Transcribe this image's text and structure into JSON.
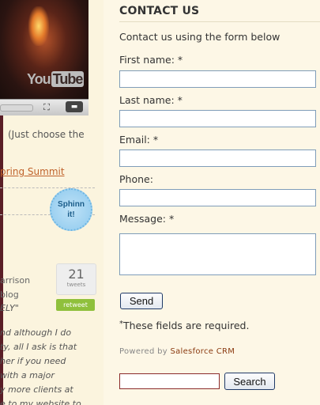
{
  "left_column": {
    "video": {
      "logo_text": "You",
      "logo_tube": "Tube"
    },
    "choose_text": "(Just choose the",
    "spring_link": "pring Summit",
    "sphinn": {
      "line1": "Sphinn",
      "line2": "it!"
    },
    "tweets": {
      "count": "21",
      "label": "tweets",
      "retweet": "retweet"
    },
    "harrison_lines": [
      "arrison",
      "blog",
      "ELY\""
    ],
    "italic_lines": [
      "nd although I do",
      "ty, all I ask is that",
      "her if you need",
      "with a major",
      "y more clients at",
      "e to my website to"
    ]
  },
  "form": {
    "heading": "CONTACT US",
    "intro": "Contact us using the form below",
    "fields": {
      "first_name": {
        "label": "First name: *",
        "value": ""
      },
      "last_name": {
        "label": "Last name: *",
        "value": ""
      },
      "email": {
        "label": "Email: *",
        "value": ""
      },
      "phone": {
        "label": "Phone:",
        "value": ""
      },
      "message": {
        "label": "Message: *",
        "value": ""
      }
    },
    "send_label": "Send",
    "required_mark": "*",
    "required_note": "These fields are required.",
    "powered_by": "Powered by",
    "powered_brand": "Salesforce CRM"
  },
  "search": {
    "value": "",
    "button_label": "Search"
  },
  "colors": {
    "page_bg": "#fdf7e6",
    "input_border": "#7f9db9",
    "button_border": "#1f3a67",
    "link": "#c0622b",
    "brand": "#8a3a10"
  }
}
